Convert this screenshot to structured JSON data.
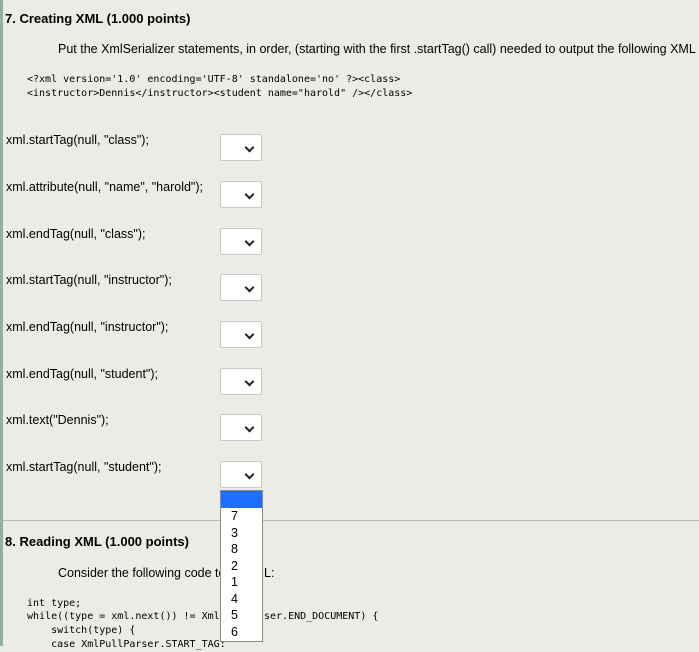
{
  "question7": {
    "title": "7. Creating XML (1.000 points)",
    "instruction": "Put the XmlSerializer statements, in order, (starting with the first .startTag() call) needed to output the following XML :",
    "xml_line1": "<?xml version='1.0' encoding='UTF-8' standalone='no' ?><class>",
    "xml_line2": "<instructor>Dennis</instructor><student name=\"harold\" /></class>",
    "rows": [
      {
        "label": "xml.startTag(null, \"class\");",
        "value": ""
      },
      {
        "label": "xml.attribute(null, \"name\", \"harold\");",
        "value": ""
      },
      {
        "label": "xml.endTag(null, \"class\");",
        "value": ""
      },
      {
        "label": "xml.startTag(null, \"instructor\");",
        "value": ""
      },
      {
        "label": "xml.endTag(null, \"instructor\");",
        "value": ""
      },
      {
        "label": "xml.endTag(null, \"student\");",
        "value": ""
      },
      {
        "label": "xml.text(\"Dennis\");",
        "value": ""
      },
      {
        "label": "xml.startTag(null, \"student\");",
        "value": ""
      }
    ]
  },
  "dropdown_options": [
    "",
    "7",
    "3",
    "8",
    "2",
    "1",
    "4",
    "5",
    "6"
  ],
  "question8": {
    "title": "8. Reading XML (1.000 points)",
    "instruction_visible": "Consider the following code to",
    "instruction_tail": "L:",
    "code_line1": "int type;",
    "code_line2_a": "while((type = xml.next()) != Xml",
    "code_line2_b": "ser.END_DOCUMENT) {",
    "code_line3": "    switch(type) {",
    "code_line4": "    case XmlPullParser.START_TAG:"
  },
  "colors": {
    "background": "#ecece6",
    "highlight": "#1e6fff",
    "left_rule": "#8fb39a"
  }
}
